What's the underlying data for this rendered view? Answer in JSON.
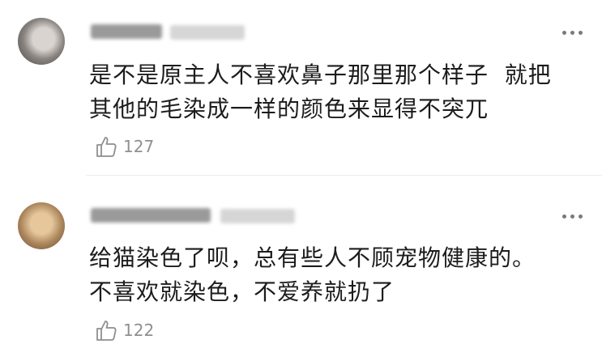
{
  "comments": [
    {
      "content": "是不是原主人不喜欢鼻子那里那个样子  就把\n其他的毛染成一样的颜色来显得不突兀",
      "like_count": "127"
    },
    {
      "content": "给猫染色了呗，总有些人不顾宠物健康的。\n不喜欢就染色，不爱养就扔了",
      "like_count": "122"
    }
  ]
}
